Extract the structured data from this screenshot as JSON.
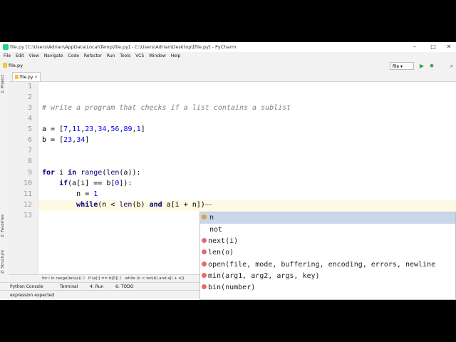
{
  "window": {
    "title": "file.py [C:\\Users\\Adrian\\AppData\\Local\\Temp\\file.py] - C:\\Users\\Adrian\\Desktop\\[file.py] - PyCharm",
    "minimize": "–",
    "maximize": "□",
    "close": "✕"
  },
  "menu": [
    "File",
    "Edit",
    "View",
    "Navigate",
    "Code",
    "Refactor",
    "Run",
    "Tools",
    "VCS",
    "Window",
    "Help"
  ],
  "navbar": {
    "breadcrumb": "file.py",
    "run_config": "file ▾",
    "run_icon": "▶",
    "debug_icon": "✹",
    "search_icon": "⌕"
  },
  "tabs": [
    {
      "label": "file.py",
      "close": "×"
    }
  ],
  "left_tools": {
    "project": "1: Project",
    "favorites": "2: Favorites",
    "structure": "Z: Structure"
  },
  "editor": {
    "line_numbers": [
      "1",
      "2",
      "3",
      "4",
      "5",
      "6",
      "7",
      "8",
      "9",
      "10",
      "11",
      "12",
      "13"
    ],
    "comment": "# write a program that checks if a list contains a sublist",
    "a_prefix": "a = [",
    "a_nums": [
      "7",
      "11",
      "23",
      "34",
      "56",
      "89",
      "1"
    ],
    "b_prefix": "b = [",
    "b_nums": [
      "23",
      "34"
    ],
    "for_kw": "for",
    "for_mid": " i ",
    "in_kw": "in",
    "range_fn": "range",
    "len_fn": "len",
    "for_end": "(a)):",
    "if_kw": "if",
    "if_mid": "(a[i] == b[",
    "zero": "0",
    "if_end": "]):",
    "n_assign": "n = ",
    "one": "1",
    "while_kw": "while",
    "while_mid": "(n < ",
    "while_mid2": "(b) ",
    "and_kw": "and",
    "while_end": " a[i + n])",
    "wave": "~~"
  },
  "autocomplete": {
    "items": [
      {
        "text": "n",
        "icon": "variable-icon"
      },
      {
        "text": "not",
        "icon": ""
      },
      {
        "text": "next(i)",
        "icon": "function-icon"
      },
      {
        "text": "len(o)",
        "icon": "function-icon"
      },
      {
        "text": "open(file, mode, buffering, encoding, errors, newline",
        "icon": "function-icon"
      },
      {
        "text": "min(arg1, arg2, args, key)",
        "icon": "function-icon"
      },
      {
        "text": "bin(number)",
        "icon": "function-icon"
      }
    ]
  },
  "breadcrumbs_bottom": "for i in range(len(a))   〉  if (a[i] == b[0])   〉  while (n < len(b) and a[i + n])",
  "tool_windows": {
    "python_console": "Python Console",
    "terminal": "Terminal",
    "run": "4: Run",
    "todo": "6: TODO"
  },
  "status": {
    "message": "expression expected"
  }
}
